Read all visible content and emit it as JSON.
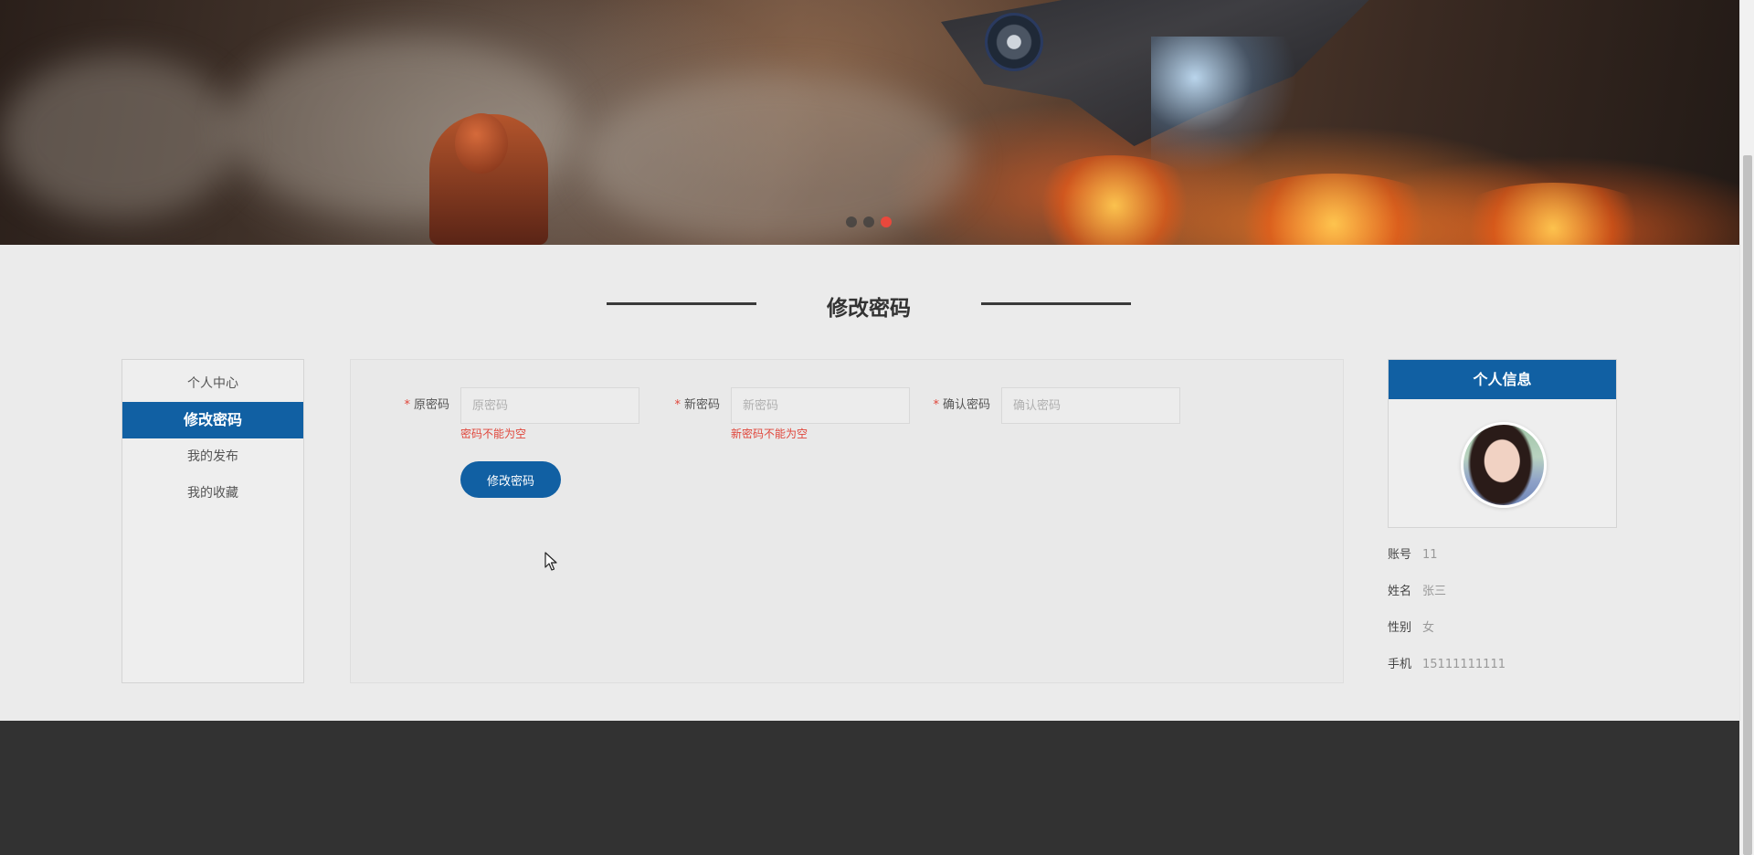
{
  "banner": {
    "carousel_dots": [
      {
        "active": false
      },
      {
        "active": false
      },
      {
        "active": true
      }
    ]
  },
  "page_title": "修改密码",
  "side_menu": {
    "items": [
      {
        "label": "个人中心",
        "active": false
      },
      {
        "label": "修改密码",
        "active": true
      },
      {
        "label": "我的发布",
        "active": false
      },
      {
        "label": "我的收藏",
        "active": false
      }
    ]
  },
  "form": {
    "old_password": {
      "label": "原密码",
      "placeholder": "原密码",
      "value": "",
      "error": "密码不能为空"
    },
    "new_password": {
      "label": "新密码",
      "placeholder": "新密码",
      "value": "",
      "error": "新密码不能为空"
    },
    "confirm_password": {
      "label": "确认密码",
      "placeholder": "确认密码",
      "value": ""
    },
    "required_mark": "*",
    "submit_label": "修改密码"
  },
  "profile": {
    "title": "个人信息",
    "fields": [
      {
        "key": "账号",
        "value": "11"
      },
      {
        "key": "姓名",
        "value": "张三"
      },
      {
        "key": "性别",
        "value": "女"
      },
      {
        "key": "手机",
        "value": "15111111111"
      }
    ]
  },
  "colors": {
    "primary": "#1160a3",
    "error": "#e0463b",
    "footer": "#323232",
    "dot_active": "#e9483c"
  }
}
